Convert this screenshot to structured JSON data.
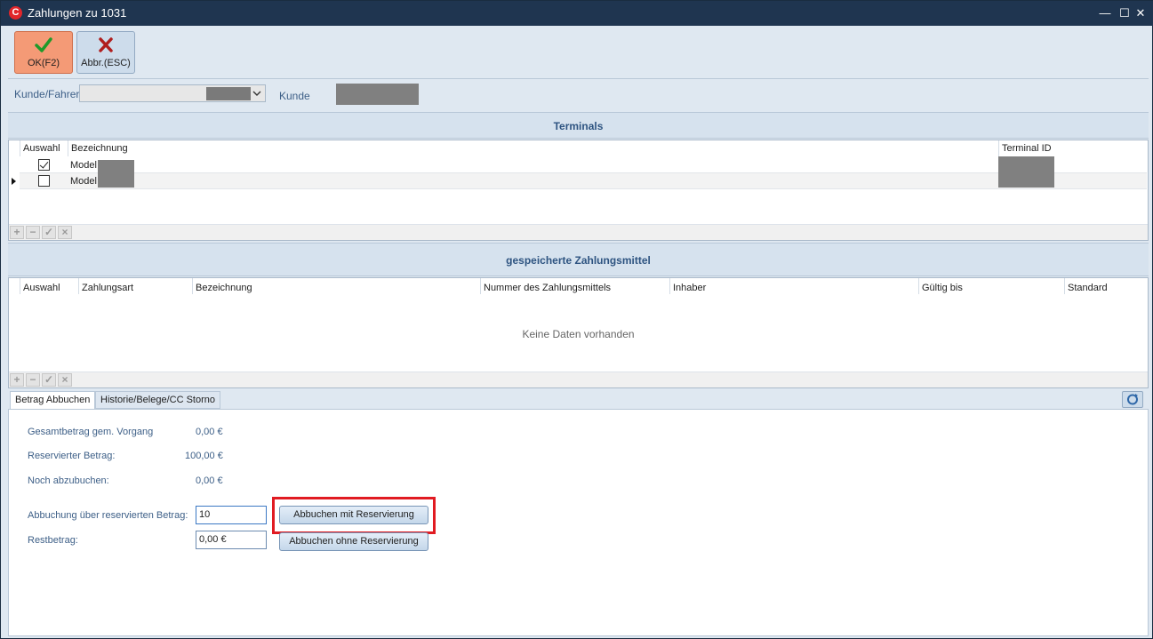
{
  "window": {
    "title": "Zahlungen zu 1031",
    "icon_letter": "C",
    "controls": {
      "minimize": "—",
      "maximize": "☐",
      "close": "✕"
    }
  },
  "toolbar": {
    "ok_label": "OK(F2)",
    "ok_icon": "checkmark-icon",
    "cancel_label": "Abbr.(ESC)",
    "cancel_icon": "x-icon"
  },
  "customer": {
    "driver_label": "Kunde/Fahrer",
    "customer_label": "Kunde"
  },
  "terminals": {
    "title": "Terminals",
    "columns": [
      "Auswahl",
      "Bezeichnung",
      "Terminal ID"
    ],
    "rows": [
      {
        "selected": true,
        "name": "Model"
      },
      {
        "selected": false,
        "name": "Model"
      }
    ]
  },
  "payment_methods": {
    "title": "gespeicherte Zahlungsmittel",
    "columns": [
      "Auswahl",
      "Zahlungsart",
      "Bezeichnung",
      "Nummer des Zahlungsmittels",
      "Inhaber",
      "Gültig bis",
      "Standard"
    ],
    "empty_text": "Keine Daten vorhanden"
  },
  "tabs": [
    "Betrag Abbuchen",
    "Historie/Belege/CC Storno"
  ],
  "booking": {
    "total_label": "Gesamtbetrag gem. Vorgang",
    "total_value": "0,00 €",
    "reserved_label": "Reservierter Betrag:",
    "reserved_value": "100,00 €",
    "remaining_label": "Noch abzubuchen:",
    "remaining_value": "0,00 €",
    "charge_label": "Abbuchung über reservierten Betrag:",
    "charge_value": "10",
    "rest_label": "Restbetrag:",
    "rest_value": "0,00 €",
    "btn_with_reservation": "Abbuchen mit Reservierung",
    "btn_without_reservation": "Abbuchen ohne Reservierung"
  },
  "colors": {
    "titlebar": "#1f3550",
    "ok_button": "#f49a76",
    "accent_text": "#3d5f87",
    "highlight": "#e11b22"
  }
}
